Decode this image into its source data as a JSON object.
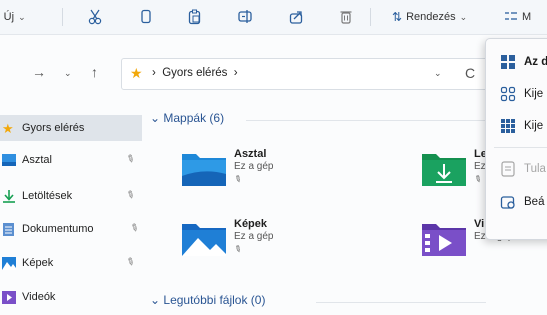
{
  "toolbar": {
    "new_label": "Új",
    "sort_label": "Rendezés",
    "view_label": "M"
  },
  "address": {
    "breadcrumb": "Gyors elérés"
  },
  "sidebar": {
    "items": [
      {
        "label": "Gyors elérés",
        "icon": "star-icon"
      },
      {
        "label": "Asztal",
        "icon": "desktop-icon"
      },
      {
        "label": "Letöltések",
        "icon": "download-icon"
      },
      {
        "label": "Dokumentumo",
        "icon": "documents-icon"
      },
      {
        "label": "Képek",
        "icon": "pictures-icon"
      },
      {
        "label": "Videók",
        "icon": "videos-icon"
      }
    ]
  },
  "main": {
    "folders_header": "Mappák (6)",
    "recent_header": "Legutóbbi fájlok (0)",
    "folders": [
      {
        "name": "Asztal",
        "sub": "Ez a gép"
      },
      {
        "name": "Le",
        "sub": "Ez"
      },
      {
        "name": "Képek",
        "sub": "Ez a gép"
      },
      {
        "name": "Vi",
        "sub": "Ez a gép"
      }
    ]
  },
  "menu": {
    "items": [
      {
        "label": "Az d"
      },
      {
        "label": "Kije"
      },
      {
        "label": "Kije"
      },
      {
        "label": "Tula"
      },
      {
        "label": "Beá"
      }
    ]
  },
  "colors": {
    "accent": "#2b5f9d",
    "folder_blue": "#1e88d8",
    "folder_green": "#1aa260",
    "star": "#f2a80a"
  }
}
